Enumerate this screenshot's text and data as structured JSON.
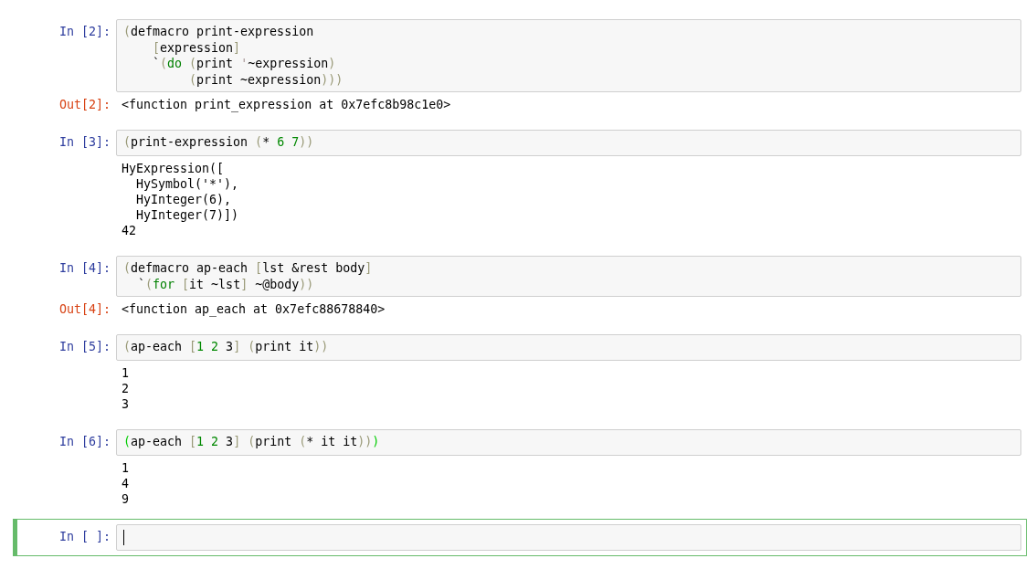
{
  "cells": [
    {
      "prompt": "In [2]:",
      "selected": false,
      "code": [
        [
          {
            "text": "(",
            "kind": "bracket"
          },
          {
            "text": "defmacro print-expression",
            "kind": "plain"
          }
        ],
        [
          {
            "text": "    [",
            "kind": "bracket"
          },
          {
            "text": "expression",
            "kind": "plain"
          },
          {
            "text": "]",
            "kind": "bracket"
          }
        ],
        [
          {
            "text": "    `",
            "kind": "plain"
          },
          {
            "text": "(",
            "kind": "bracket"
          },
          {
            "text": "do",
            "kind": "keyword"
          },
          {
            "text": " (",
            "kind": "bracket"
          },
          {
            "text": "print ",
            "kind": "plain"
          },
          {
            "text": "'",
            "kind": "quote"
          },
          {
            "text": "~expression",
            "kind": "plain"
          },
          {
            "text": ")",
            "kind": "bracket"
          }
        ],
        [
          {
            "text": "         (",
            "kind": "bracket"
          },
          {
            "text": "print ~expression",
            "kind": "plain"
          },
          {
            "text": ")))",
            "kind": "bracket"
          }
        ]
      ],
      "output": {
        "kind": "result",
        "prompt": "Out[2]:",
        "lines": [
          "<function print_expression at 0x7efc8b98c1e0>"
        ]
      }
    },
    {
      "prompt": "In [3]:",
      "selected": false,
      "code": [
        [
          {
            "text": "(",
            "kind": "bracket"
          },
          {
            "text": "print-expression ",
            "kind": "plain"
          },
          {
            "text": "(",
            "kind": "bracket"
          },
          {
            "text": "* ",
            "kind": "plain"
          },
          {
            "text": "6 7",
            "kind": "number"
          },
          {
            "text": "))",
            "kind": "bracket"
          }
        ]
      ],
      "output": {
        "kind": "stream",
        "lines": [
          "HyExpression([",
          "  HySymbol('*'),",
          "  HyInteger(6),",
          "  HyInteger(7)])",
          "42"
        ]
      }
    },
    {
      "prompt": "In [4]:",
      "selected": false,
      "code": [
        [
          {
            "text": "(",
            "kind": "bracket"
          },
          {
            "text": "defmacro ap-each ",
            "kind": "plain"
          },
          {
            "text": "[",
            "kind": "bracket"
          },
          {
            "text": "lst &rest body",
            "kind": "plain"
          },
          {
            "text": "]",
            "kind": "bracket"
          }
        ],
        [
          {
            "text": "  `",
            "kind": "plain"
          },
          {
            "text": "(",
            "kind": "bracket"
          },
          {
            "text": "for",
            "kind": "keyword"
          },
          {
            "text": " [",
            "kind": "bracket"
          },
          {
            "text": "it ~lst",
            "kind": "plain"
          },
          {
            "text": "]",
            "kind": "bracket"
          },
          {
            "text": " ~@body",
            "kind": "plain"
          },
          {
            "text": "))",
            "kind": "bracket"
          }
        ]
      ],
      "output": {
        "kind": "result",
        "prompt": "Out[4]:",
        "lines": [
          "<function ap_each at 0x7efc88678840>"
        ]
      }
    },
    {
      "prompt": "In [5]:",
      "selected": false,
      "code": [
        [
          {
            "text": "(",
            "kind": "bracket"
          },
          {
            "text": "ap-each ",
            "kind": "plain"
          },
          {
            "text": "[",
            "kind": "bracket"
          },
          {
            "text": "1 2",
            "kind": "number"
          },
          {
            "text": " 3",
            "kind": "plain"
          },
          {
            "text": "] (",
            "kind": "bracket"
          },
          {
            "text": "print it",
            "kind": "plain"
          },
          {
            "text": "))",
            "kind": "bracket"
          }
        ]
      ],
      "output": {
        "kind": "stream",
        "lines": [
          "1",
          "2",
          "3"
        ]
      }
    },
    {
      "prompt": "In [6]:",
      "selected": false,
      "code": [
        [
          {
            "text": "(",
            "kind": "match"
          },
          {
            "text": "ap-each ",
            "kind": "plain"
          },
          {
            "text": "[",
            "kind": "bracket"
          },
          {
            "text": "1 2",
            "kind": "number"
          },
          {
            "text": " 3",
            "kind": "plain"
          },
          {
            "text": "] (",
            "kind": "bracket"
          },
          {
            "text": "print ",
            "kind": "plain"
          },
          {
            "text": "(",
            "kind": "bracket"
          },
          {
            "text": "* it it",
            "kind": "plain"
          },
          {
            "text": "))",
            "kind": "bracket"
          },
          {
            "text": ")",
            "kind": "match"
          }
        ]
      ],
      "output": {
        "kind": "stream",
        "lines": [
          "1",
          "4",
          "9"
        ]
      }
    },
    {
      "prompt": "In [ ]:",
      "selected": true
    }
  ]
}
